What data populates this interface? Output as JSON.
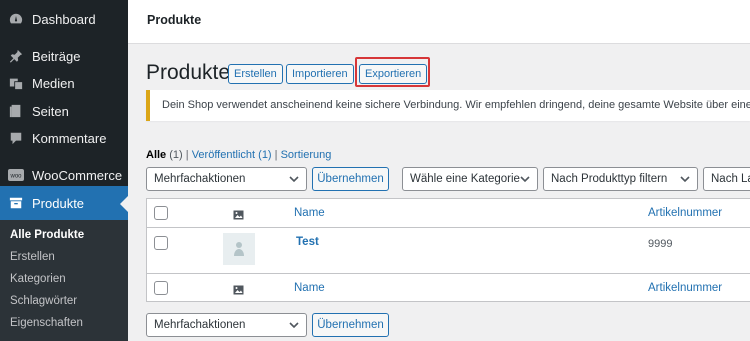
{
  "sidebar": {
    "items": [
      {
        "label": "Dashboard",
        "icon": "dashboard-icon"
      },
      {
        "label": "Beiträge",
        "icon": "pin-icon"
      },
      {
        "label": "Medien",
        "icon": "media-icon"
      },
      {
        "label": "Seiten",
        "icon": "page-icon"
      },
      {
        "label": "Kommentare",
        "icon": "comment-icon"
      },
      {
        "label": "WooCommerce",
        "icon": "woo-icon"
      },
      {
        "label": "Produkte",
        "icon": "archive-icon"
      }
    ],
    "submenu": [
      "Alle Produkte",
      "Erstellen",
      "Kategorien",
      "Schlagwörter",
      "Eigenschaften"
    ]
  },
  "topbar": {
    "title": "Produkte"
  },
  "heading": {
    "title": "Produkte",
    "buttons": [
      "Erstellen",
      "Importieren",
      "Exportieren"
    ]
  },
  "notice": {
    "text": "Dein Shop verwendet anscheinend keine sichere Verbindung. Wir empfehlen dringend, deine gesamte Website über eine HTTPS-"
  },
  "filters": {
    "all_label": "Alle",
    "all_count": "(1)",
    "sep1": "|",
    "published_label": "Veröffentlicht",
    "published_count": "(1)",
    "sep2": "|",
    "sort_label": "Sortierung"
  },
  "toolbar": {
    "bulk_select": "Mehrfachaktionen",
    "apply": "Übernehmen",
    "category_select": "Wähle eine Kategorie",
    "type_select": "Nach Produkttyp filtern",
    "stock_select": "Nach La"
  },
  "table": {
    "columns": {
      "name": "Name",
      "sku": "Artikelnummer"
    },
    "rows": [
      {
        "name": "Test",
        "sku": "9999"
      }
    ]
  },
  "bottom_toolbar": {
    "bulk_select": "Mehrfachaktionen",
    "apply": "Übernehmen"
  },
  "colors": {
    "sidebar_bg": "#1d2327",
    "accent": "#2271b1",
    "highlight": "#d63638"
  }
}
